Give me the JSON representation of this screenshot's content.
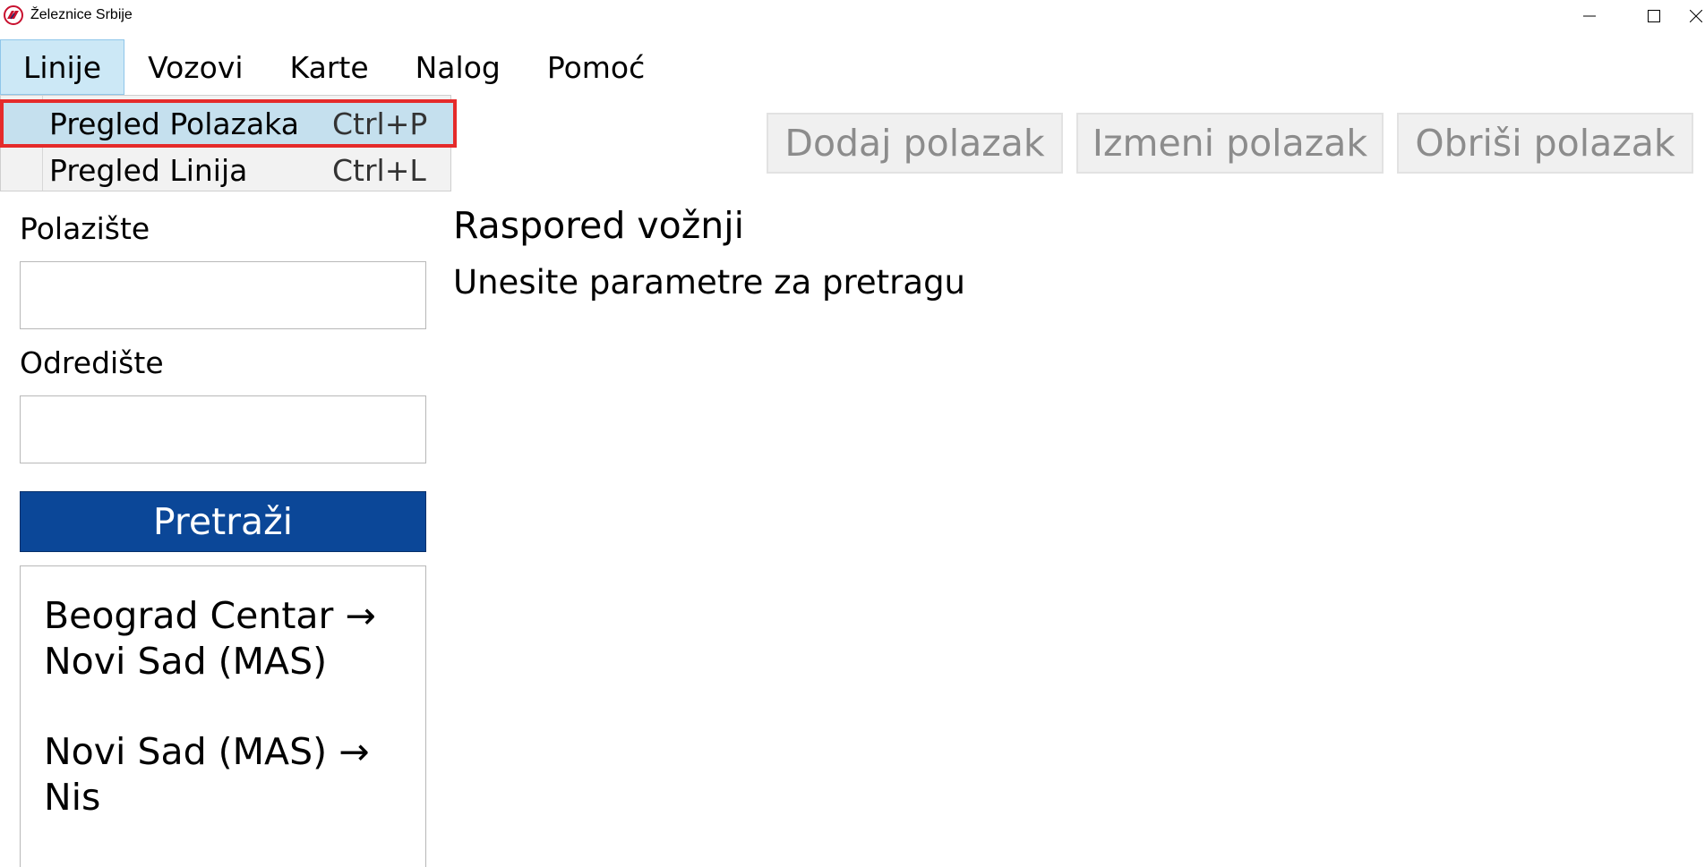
{
  "window": {
    "title": "Železnice Srbije",
    "logo_icon": "srbija-voz-logo",
    "controls": [
      "minimize-icon",
      "maximize-icon",
      "close-icon"
    ]
  },
  "menubar": {
    "items": [
      {
        "label": "Linije",
        "active": true
      },
      {
        "label": "Vozovi"
      },
      {
        "label": "Karte"
      },
      {
        "label": "Nalog"
      },
      {
        "label": "Pomoć"
      }
    ]
  },
  "dropdown": {
    "items": [
      {
        "label": "Pregled Polazaka",
        "shortcut": "Ctrl+P",
        "highlighted": true
      },
      {
        "label": "Pregled Linija",
        "shortcut": "Ctrl+L"
      }
    ]
  },
  "toolbar": {
    "add_label": "Dodaj polazak",
    "edit_label": "Izmeni polazak",
    "delete_label": "Obriši polazak"
  },
  "search": {
    "from_label": "Polazište",
    "from_value": "",
    "to_label": "Odredište",
    "to_value": "",
    "button_label": "Pretraži"
  },
  "routes": [
    {
      "line1": "Beograd Centar →",
      "line2": "Novi Sad (MAS)"
    },
    {
      "line1": "Novi Sad (MAS) →",
      "line2": "Nis"
    }
  ],
  "main": {
    "title": "Raspored vožnji",
    "subtitle": "Unesite parametre za pretragu"
  },
  "colors": {
    "accent": "#0b4798",
    "menu_active": "#cce8f6",
    "highlight_border": "#e52b2b",
    "disabled_text": "#8c8c8c"
  }
}
